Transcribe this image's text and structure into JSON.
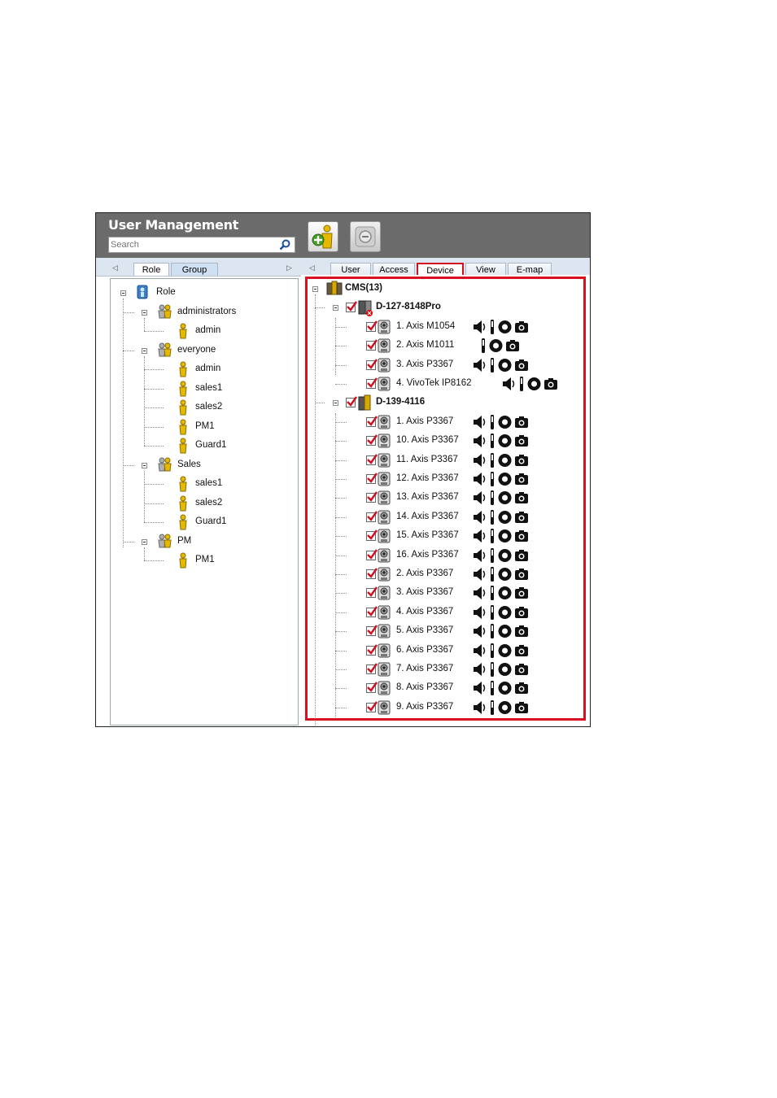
{
  "window": {
    "title": "User Management"
  },
  "search": {
    "placeholder": "Search"
  },
  "left_tabs": [
    "Role",
    "Group"
  ],
  "right_tabs": [
    "User",
    "Access",
    "Device",
    "View",
    "E-map"
  ],
  "role_tree": [
    {
      "label": "Role",
      "level": 0,
      "kind": "root"
    },
    {
      "label": "administrators",
      "level": 1,
      "kind": "group"
    },
    {
      "label": "admin",
      "level": 2,
      "kind": "user"
    },
    {
      "label": "everyone",
      "level": 1,
      "kind": "group"
    },
    {
      "label": "admin",
      "level": 2,
      "kind": "user"
    },
    {
      "label": "sales1",
      "level": 2,
      "kind": "user"
    },
    {
      "label": "sales2",
      "level": 2,
      "kind": "user"
    },
    {
      "label": "PM1",
      "level": 2,
      "kind": "user"
    },
    {
      "label": "Guard1",
      "level": 2,
      "kind": "user"
    },
    {
      "label": "Sales",
      "level": 1,
      "kind": "group"
    },
    {
      "label": "sales1",
      "level": 2,
      "kind": "user"
    },
    {
      "label": "sales2",
      "level": 2,
      "kind": "user"
    },
    {
      "label": "Guard1",
      "level": 2,
      "kind": "user"
    },
    {
      "label": "PM",
      "level": 1,
      "kind": "group"
    },
    {
      "label": "PM1",
      "level": 2,
      "kind": "user"
    }
  ],
  "device_tree": [
    {
      "label": "CMS(13)",
      "level": 0,
      "kind": "cms",
      "bold": true
    },
    {
      "label": "D-127-8148Pro",
      "level": 1,
      "kind": "server-error",
      "bold": true,
      "checked": true
    },
    {
      "label": "1. Axis M1054",
      "level": 2,
      "kind": "camera",
      "checked": true,
      "icons": [
        "speaker-icon",
        "io-icon",
        "record-icon",
        "snapshot-icon"
      ]
    },
    {
      "label": "2. Axis M1011",
      "level": 2,
      "kind": "camera",
      "checked": true,
      "icons": [
        "io-icon",
        "record-icon",
        "snapshot-icon"
      ]
    },
    {
      "label": "3. Axis P3367",
      "level": 2,
      "kind": "camera",
      "checked": true,
      "icons": [
        "speaker-icon",
        "io-icon",
        "record-icon",
        "snapshot-icon"
      ]
    },
    {
      "label": "4. VivoTek IP8162",
      "level": 2,
      "kind": "camera",
      "checked": true,
      "icons": [
        "speaker-icon",
        "io-icon",
        "record-icon",
        "snapshot-icon"
      ]
    },
    {
      "label": "D-139-4116",
      "level": 1,
      "kind": "server",
      "bold": true,
      "checked": true
    },
    {
      "label": "1. Axis P3367",
      "level": 2,
      "kind": "camera",
      "checked": true,
      "icons": [
        "speaker-icon",
        "io-icon",
        "record-icon",
        "snapshot-icon"
      ]
    },
    {
      "label": "10. Axis P3367",
      "level": 2,
      "kind": "camera",
      "checked": true,
      "icons": [
        "speaker-icon",
        "io-icon",
        "record-icon",
        "snapshot-icon"
      ]
    },
    {
      "label": "11. Axis P3367",
      "level": 2,
      "kind": "camera",
      "checked": true,
      "icons": [
        "speaker-icon",
        "io-icon",
        "record-icon",
        "snapshot-icon"
      ]
    },
    {
      "label": "12. Axis P3367",
      "level": 2,
      "kind": "camera",
      "checked": true,
      "icons": [
        "speaker-icon",
        "io-icon",
        "record-icon",
        "snapshot-icon"
      ]
    },
    {
      "label": "13. Axis P3367",
      "level": 2,
      "kind": "camera",
      "checked": true,
      "icons": [
        "speaker-icon",
        "io-icon",
        "record-icon",
        "snapshot-icon"
      ]
    },
    {
      "label": "14. Axis P3367",
      "level": 2,
      "kind": "camera",
      "checked": true,
      "icons": [
        "speaker-icon",
        "io-icon",
        "record-icon",
        "snapshot-icon"
      ]
    },
    {
      "label": "15. Axis P3367",
      "level": 2,
      "kind": "camera",
      "checked": true,
      "icons": [
        "speaker-icon",
        "io-icon",
        "record-icon",
        "snapshot-icon"
      ]
    },
    {
      "label": "16. Axis P3367",
      "level": 2,
      "kind": "camera",
      "checked": true,
      "icons": [
        "speaker-icon",
        "io-icon",
        "record-icon",
        "snapshot-icon"
      ]
    },
    {
      "label": "2. Axis P3367",
      "level": 2,
      "kind": "camera",
      "checked": true,
      "icons": [
        "speaker-icon",
        "io-icon",
        "record-icon",
        "snapshot-icon"
      ]
    },
    {
      "label": "3. Axis P3367",
      "level": 2,
      "kind": "camera",
      "checked": true,
      "icons": [
        "speaker-icon",
        "io-icon",
        "record-icon",
        "snapshot-icon"
      ]
    },
    {
      "label": "4. Axis P3367",
      "level": 2,
      "kind": "camera",
      "checked": true,
      "icons": [
        "speaker-icon",
        "io-icon",
        "record-icon",
        "snapshot-icon"
      ]
    },
    {
      "label": "5. Axis P3367",
      "level": 2,
      "kind": "camera",
      "checked": true,
      "icons": [
        "speaker-icon",
        "io-icon",
        "record-icon",
        "snapshot-icon"
      ]
    },
    {
      "label": "6. Axis P3367",
      "level": 2,
      "kind": "camera",
      "checked": true,
      "icons": [
        "speaker-icon",
        "io-icon",
        "record-icon",
        "snapshot-icon"
      ]
    },
    {
      "label": "7. Axis P3367",
      "level": 2,
      "kind": "camera",
      "checked": true,
      "icons": [
        "speaker-icon",
        "io-icon",
        "record-icon",
        "snapshot-icon"
      ]
    },
    {
      "label": "8. Axis P3367",
      "level": 2,
      "kind": "camera",
      "checked": true,
      "icons": [
        "speaker-icon",
        "io-icon",
        "record-icon",
        "snapshot-icon"
      ]
    },
    {
      "label": "9. Axis P3367",
      "level": 2,
      "kind": "camera",
      "checked": true,
      "icons": [
        "speaker-icon",
        "io-icon",
        "record-icon",
        "snapshot-icon"
      ]
    }
  ],
  "colors": {
    "header_bg": "#6b6b6b",
    "highlight_red": "#d81020",
    "tab_bg": "#dde6f0"
  }
}
